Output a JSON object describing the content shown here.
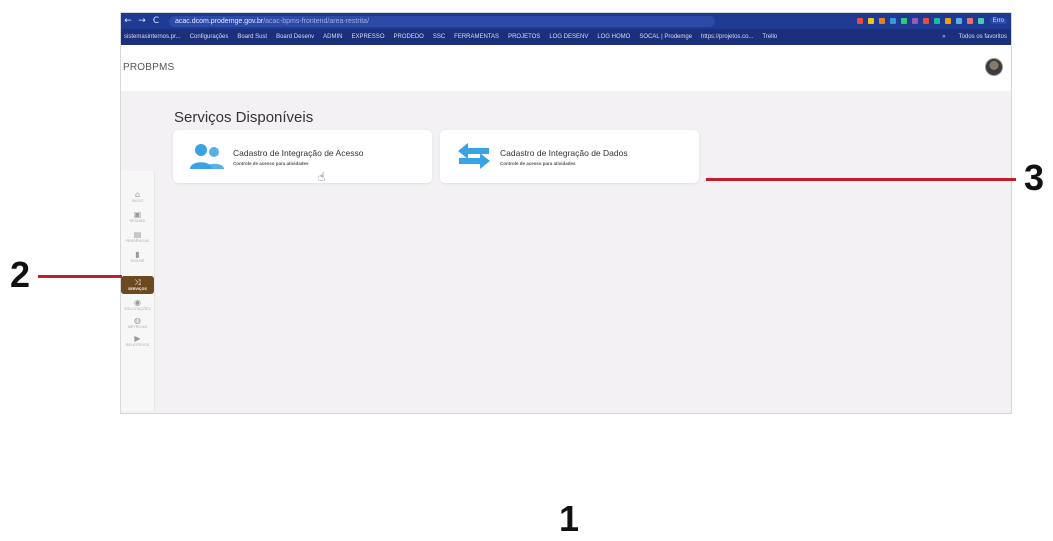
{
  "browser": {
    "nav": {
      "back": "←",
      "forward": "→",
      "reload": "C"
    },
    "url_host": "acac.dcom.prodemge.gov.br",
    "url_path": "/acac-bpms-frontend/area-restrita/",
    "bookmarks": [
      "sistemasinternos.pr...",
      "Configurações",
      "Board Sust",
      "Board Desenv",
      "ADMIN",
      "EXPRESSO",
      "PRODEDO",
      "SSC",
      "FERRAMENTAS",
      "PROJETOS",
      "LOG DESENV",
      "LOG HOMO",
      "SOCAL | Prodemge",
      "https://projetos.co...",
      "Trello"
    ],
    "bookmarks_more": "»",
    "bookmarks_all": "Todos os favoritos",
    "profile_label": "Erro",
    "ext_colors": [
      "#e74c3c",
      "#f1c40f",
      "#e67e22",
      "#3498db",
      "#2ecc71",
      "#9b59b6",
      "#e74c3c",
      "#1abc9c",
      "#f39c12",
      "#5dade2",
      "#ec7063",
      "#48c9b0"
    ]
  },
  "app": {
    "brand": "PROBPMS",
    "page_title": "Serviços Disponíveis",
    "sidebar": {
      "items": [
        {
          "icon": "⌂",
          "label": "INÍCIO"
        },
        {
          "icon": "▣",
          "label": "RESUMO"
        },
        {
          "icon": "▤",
          "label": "PENDÊNCIAS"
        },
        {
          "icon": "▮",
          "label": "DOSSIÊ"
        },
        {
          "icon": "⤨",
          "label": "SERVIÇOS"
        },
        {
          "icon": "◉",
          "label": "SOLICITAÇÕES"
        },
        {
          "icon": "◍",
          "label": "MÉTRICAS"
        },
        {
          "icon": "▶",
          "label": "RELATÓRIOS"
        }
      ],
      "active_index": 4
    },
    "cards": [
      {
        "title": "Cadastro de Integração de Acesso",
        "subtitle": "Controle de acesso para atividades",
        "icon": "users-icon"
      },
      {
        "title": "Cadastro de Integração de Dados",
        "subtitle": "Controle de acesso para atividades",
        "icon": "swap-arrows-icon"
      }
    ]
  },
  "annotations": {
    "one": "1",
    "two": "2",
    "three": "3"
  },
  "colors": {
    "chrome": "#1f3a93",
    "bookmarks": "#1b2f7a",
    "accent": "#6b4a1f",
    "annotation_line": "#c01e2a",
    "icon_blue": "#3aa3e3"
  }
}
